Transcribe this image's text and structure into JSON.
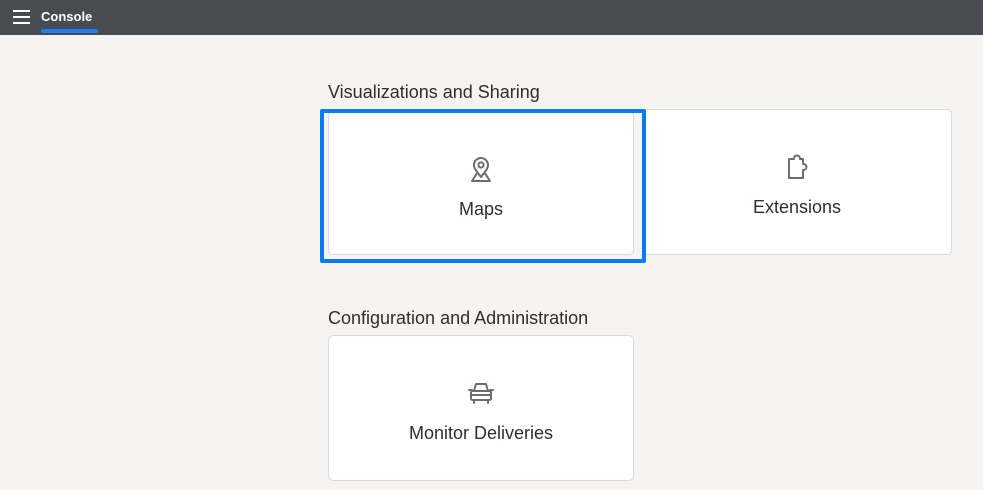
{
  "header": {
    "menu_icon": "hamburger-menu-icon",
    "title": "Console",
    "accent_color": "#1e7ef2",
    "background_color": "#484b51"
  },
  "sections": [
    {
      "heading": "Visualizations and Sharing",
      "cards": [
        {
          "label": "Maps",
          "icon": "map-pin-icon",
          "focused": true
        },
        {
          "label": "Extensions",
          "icon": "puzzle-piece-icon",
          "focused": false
        }
      ]
    },
    {
      "heading": "Configuration and Administration",
      "cards": [
        {
          "label": "Monitor Deliveries",
          "icon": "car-icon",
          "focused": false
        }
      ]
    }
  ],
  "colors": {
    "page_background": "#f5f4f2",
    "card_background": "#ffffff",
    "focus_ring": "#0a7cf2",
    "icon_stroke": "#6f6c69"
  }
}
